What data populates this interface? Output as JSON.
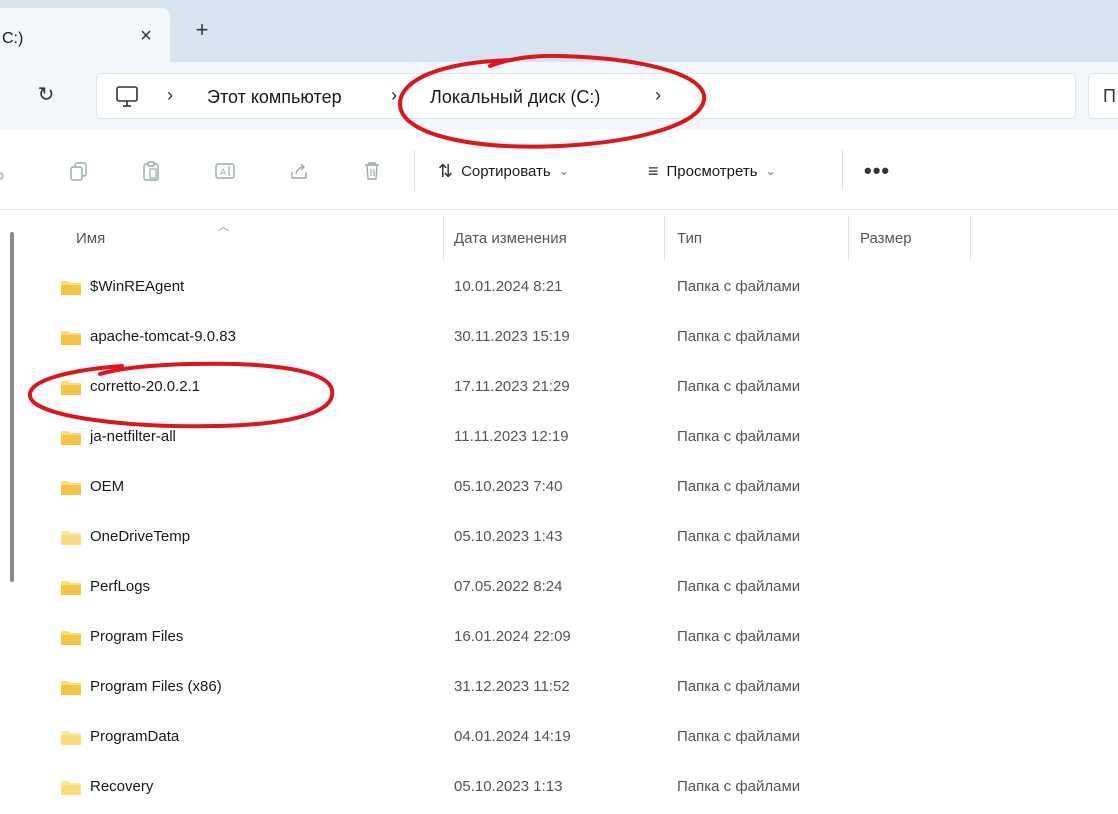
{
  "tab": {
    "title": "C:)",
    "close_glyph": "×",
    "new_glyph": "+"
  },
  "address": {
    "refresh_glyph": "↻",
    "crumbs": [
      "Этот компьютер",
      "Локальный диск (C:)"
    ],
    "sep": "›",
    "search_fragment": "П"
  },
  "toolbar": {
    "sort_label": "Сортировать",
    "view_label": "Просмотреть",
    "more_glyph": "•••",
    "chevron": "⌄"
  },
  "columns": {
    "name": "Имя",
    "date": "Дата изменения",
    "type": "Тип",
    "size": "Размер"
  },
  "files": [
    {
      "name": "$WinREAgent",
      "date": "10.01.2024 8:21",
      "type": "Папка с файлами"
    },
    {
      "name": "apache-tomcat-9.0.83",
      "date": "30.11.2023 15:19",
      "type": "Папка с файлами"
    },
    {
      "name": "corretto-20.0.2.1",
      "date": "17.11.2023 21:29",
      "type": "Папка с файлами"
    },
    {
      "name": "ja-netfilter-all",
      "date": "11.11.2023 12:19",
      "type": "Папка с файлами"
    },
    {
      "name": "OEM",
      "date": "05.10.2023 7:40",
      "type": "Папка с файлами"
    },
    {
      "name": "OneDriveTemp",
      "date": "05.10.2023 1:43",
      "type": "Папка с файлами"
    },
    {
      "name": "PerfLogs",
      "date": "07.05.2022 8:24",
      "type": "Папка с файлами"
    },
    {
      "name": "Program Files",
      "date": "16.01.2024 22:09",
      "type": "Папка с файлами"
    },
    {
      "name": "Program Files (x86)",
      "date": "31.12.2023 11:52",
      "type": "Папка с файлами"
    },
    {
      "name": "ProgramData",
      "date": "04.01.2024 14:19",
      "type": "Папка с файлами"
    },
    {
      "name": "Recovery",
      "date": "05.10.2023 1:13",
      "type": "Папка с файлами"
    }
  ],
  "colors": {
    "folder": "#f4c542",
    "folder_light": "#f9dc7c",
    "annotation": "#e0141e"
  }
}
